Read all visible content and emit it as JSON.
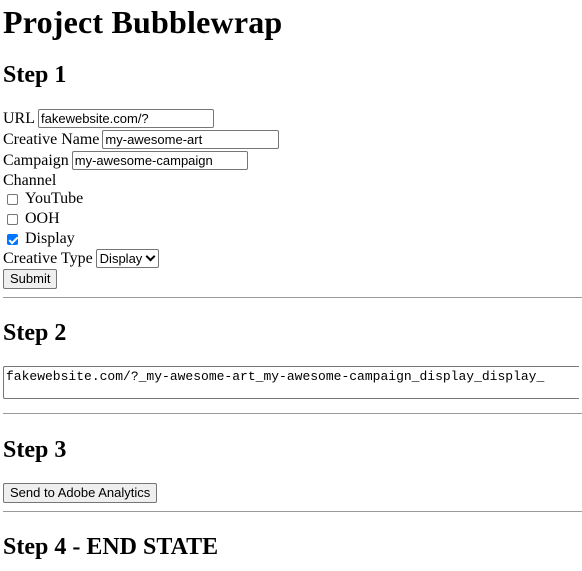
{
  "page": {
    "title": "Project Bubblewrap"
  },
  "step1": {
    "heading": "Step 1",
    "url_label": "URL",
    "url_value": "fakewebsite.com/?",
    "creative_name_label": "Creative Name",
    "creative_name_value": "my-awesome-art",
    "campaign_label": "Campaign",
    "campaign_value": "my-awesome-campaign",
    "channel_label": "Channel",
    "channels": [
      {
        "label": "YouTube",
        "checked": false
      },
      {
        "label": "OOH",
        "checked": false
      },
      {
        "label": "Display",
        "checked": true
      }
    ],
    "creative_type_label": "Creative Type",
    "creative_type_value": "Display",
    "submit_label": "Submit"
  },
  "step2": {
    "heading": "Step 2",
    "output_value": "fakewebsite.com/?_my-awesome-art_my-awesome-campaign_display_display_"
  },
  "step3": {
    "heading": "Step 3",
    "send_label": "Send to Adobe Analytics"
  },
  "step4": {
    "heading": "Step 4 - END STATE"
  },
  "colors": {
    "checkbox_checked": "#0075ff",
    "button_bg": "#efefef",
    "border": "#767676"
  }
}
